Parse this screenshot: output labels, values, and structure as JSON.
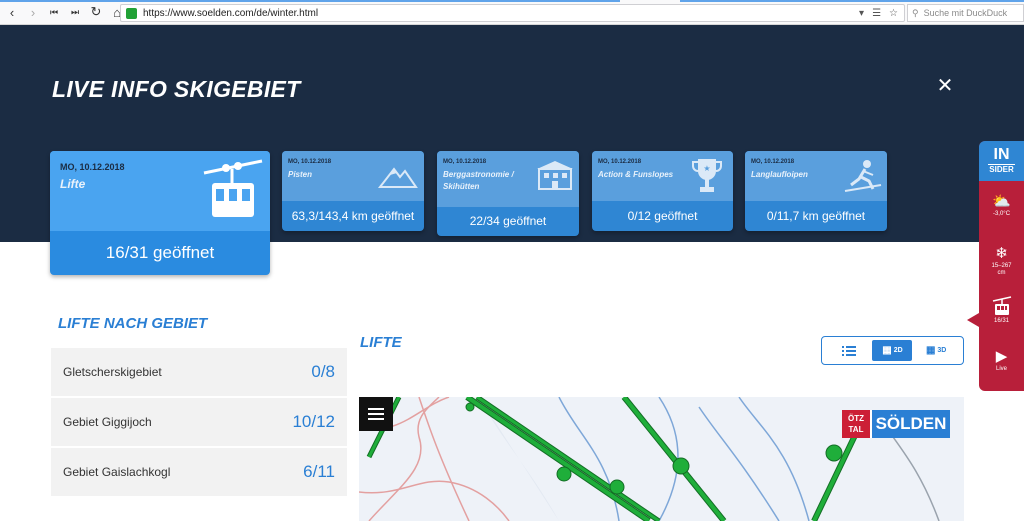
{
  "browser": {
    "url": "https://www.soelden.com/de/winter.html",
    "search_placeholder": "Suche mit DuckDuck"
  },
  "header": {
    "title": "LIVE INFO SKIGEBIET"
  },
  "cards": [
    {
      "date": "MO, 10.12.2018",
      "name": "Lifte",
      "count": "16/31 geöffnet",
      "icon": "gondola-icon"
    },
    {
      "date": "MO, 10.12.2018",
      "name": "Pisten",
      "count": "63,3/143,4 km geöffnet",
      "icon": "mountain-icon"
    },
    {
      "date": "MO, 10.12.2018",
      "name": "Berggastronomie / Skihütten",
      "count": "22/34 geöffnet",
      "icon": "hut-icon"
    },
    {
      "date": "MO, 10.12.2018",
      "name": "Action & Funslopes",
      "count": "0/12 geöffnet",
      "icon": "trophy-icon"
    },
    {
      "date": "MO, 10.12.2018",
      "name": "Langlaufloipen",
      "count": "0/11,7 km geöffnet",
      "icon": "cross-country-skier-icon"
    }
  ],
  "insider": {
    "brand_top": "IN",
    "brand_bottom": "SIDER",
    "items": [
      {
        "label": "-3,0°C",
        "icon": "weather-icon"
      },
      {
        "label": "15–267 cm",
        "icon": "snowflake-icon"
      },
      {
        "label": "16/31",
        "icon": "gondola-icon"
      },
      {
        "label": "Live",
        "icon": "video-icon"
      }
    ]
  },
  "areas": {
    "title": "LIFTE NACH GEBIET",
    "rows": [
      {
        "label": "Gletscherskigebiet",
        "value": "0/8"
      },
      {
        "label": "Gebiet Giggijoch",
        "value": "10/12"
      },
      {
        "label": "Gebiet Gaislachkogl",
        "value": "6/11"
      }
    ]
  },
  "map_section": {
    "title": "LIFTE",
    "view_options": [
      "list",
      "2D",
      "3D"
    ],
    "active_view": "2D",
    "logo_top": "ÖTZ TAL",
    "logo_name": "SÖLDEN"
  },
  "colors": {
    "header_bg": "#1b2c43",
    "accent_blue": "#2a7fd4",
    "card_blue": "#2f86d3",
    "insider_red": "#b81f3a",
    "lift_green": "#1fae3a"
  }
}
